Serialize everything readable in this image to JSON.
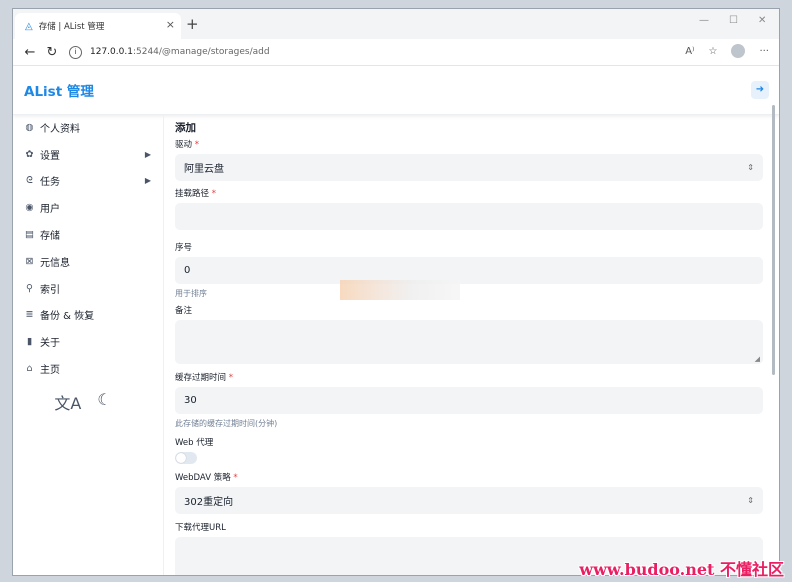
{
  "browser": {
    "tab_title": "存储 | AList 管理",
    "tab_close": "×",
    "new_tab": "+",
    "url_host": "127.0.0.1",
    "url_path": ":5244/@manage/storages/add",
    "read_aloud": "A⁾",
    "window_min": "—",
    "window_max": "☐",
    "window_close": "✕",
    "more": "···"
  },
  "app": {
    "title": "AList 管理"
  },
  "sidebar": {
    "items": [
      {
        "label": "个人资料",
        "icon": "user-circle-icon",
        "glyph": "◍"
      },
      {
        "label": "设置",
        "icon": "gear-icon",
        "glyph": "✿",
        "chevron": true
      },
      {
        "label": "任务",
        "icon": "tasks-icon",
        "glyph": "ᘓ",
        "chevron": true
      },
      {
        "label": "用户",
        "icon": "user-icon",
        "glyph": "◉"
      },
      {
        "label": "存储",
        "icon": "storage-icon",
        "glyph": "▤"
      },
      {
        "label": "元信息",
        "icon": "meta-icon",
        "glyph": "⊠"
      },
      {
        "label": "索引",
        "icon": "search-icon",
        "glyph": "⚲"
      },
      {
        "label": "备份 & 恢复",
        "icon": "database-icon",
        "glyph": "≣"
      },
      {
        "label": "关于",
        "icon": "about-icon",
        "glyph": "▮"
      },
      {
        "label": "主页",
        "icon": "home-icon",
        "glyph": "⌂"
      }
    ],
    "chevron_glyph": "▶",
    "lang_glyph": "文A",
    "theme_glyph": "☾"
  },
  "form": {
    "title": "添加",
    "driver_label": "驱动",
    "driver_value": "阿里云盘",
    "mount_label": "挂载路径",
    "mount_value": "",
    "order_label": "序号",
    "order_value": "0",
    "order_hint": "用于排序",
    "remark_label": "备注",
    "cache_label": "缓存过期时间",
    "cache_value": "30",
    "cache_hint": "此存储的缓存过期时间(分钟)",
    "webproxy_label": "Web 代理",
    "webdav_label": "WebDAV 策略",
    "webdav_value": "302重定向",
    "download_proxy_label": "下载代理URL",
    "required_mark": "*",
    "select_caret": "⇕"
  },
  "watermark": "www.budoo.net 不懂社区",
  "colors": {
    "accent": "#1e88e5",
    "required": "#e53e3e"
  }
}
